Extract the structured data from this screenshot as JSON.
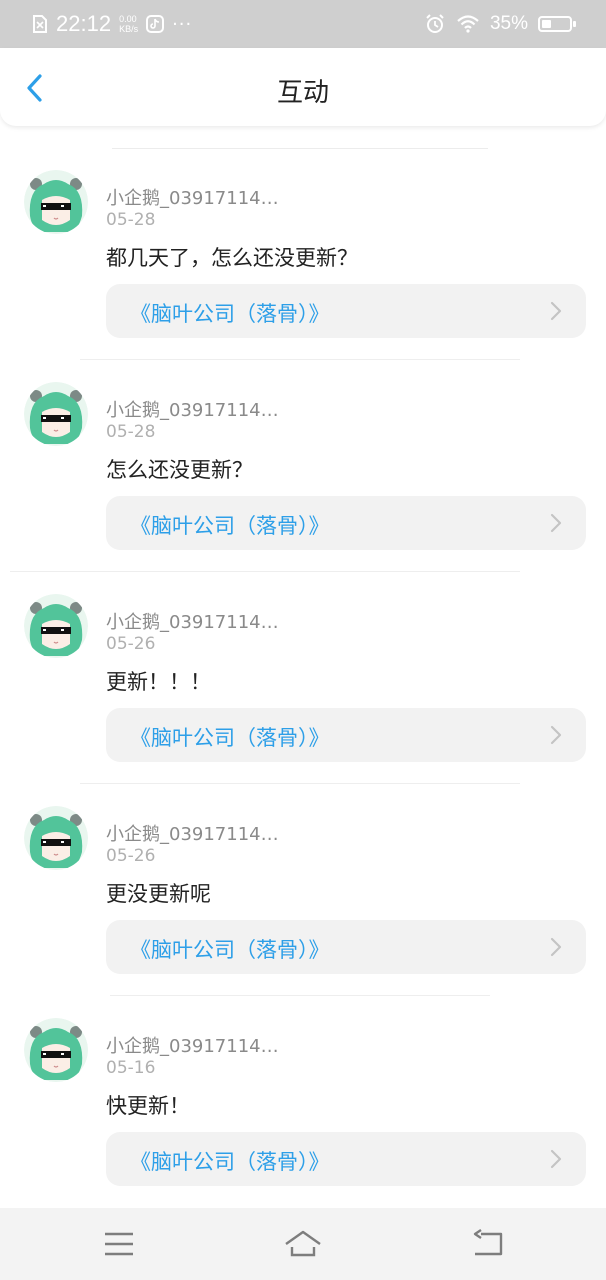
{
  "status_bar": {
    "time": "22:12",
    "speed_value": "0.00",
    "speed_unit": "KB/s",
    "more": "···",
    "battery_percent": "35%",
    "battery_level": 0.35
  },
  "header": {
    "title": "互动",
    "back_icon": "chevron-left-icon",
    "accent_color": "#2d9fe8"
  },
  "feed": {
    "items": [
      {
        "username": "小企鹅_03917114…",
        "date": "05-28",
        "content": "都几天了，怎么还没更新？",
        "book": "《脑叶公司（落骨）》"
      },
      {
        "username": "小企鹅_03917114…",
        "date": "05-28",
        "content": "怎么还没更新？",
        "book": "《脑叶公司（落骨）》"
      },
      {
        "username": "小企鹅_03917114…",
        "date": "05-26",
        "content": "更新！！！",
        "book": "《脑叶公司（落骨）》"
      },
      {
        "username": "小企鹅_03917114…",
        "date": "05-26",
        "content": "更没更新呢",
        "book": "《脑叶公司（落骨）》"
      },
      {
        "username": "小企鹅_03917114…",
        "date": "05-16",
        "content": "快更新！",
        "book": "《脑叶公司（落骨）》"
      }
    ]
  },
  "nav_bar": {
    "icons": [
      "menu-icon",
      "home-icon",
      "back-icon"
    ]
  }
}
